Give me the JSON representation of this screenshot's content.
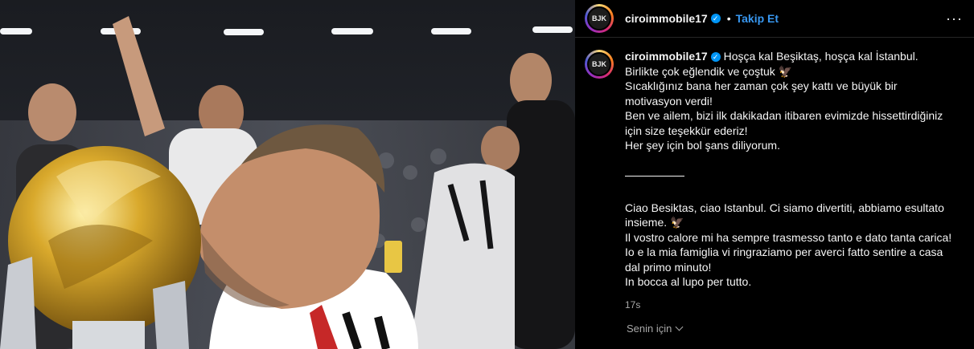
{
  "post": {
    "username": "ciroimmobile17",
    "follow_label": "Takip Et",
    "separator_dot": "•",
    "more_glyph": "···",
    "verified_glyph": "✓",
    "avatar_label": "BJK"
  },
  "caption": {
    "username": "ciroimmobile17",
    "lines": [
      "Hoşça kal Beşiktaş, hoşça kal İstanbul. Birlikte çok eğlendik ve çoştuk 🦅",
      "Sıcaklığınız bana her zaman çok şey kattı ve büyük bir motivasyon verdi!",
      "Ben ve ailem, bizi ilk dakikadan itibaren evimizde hissettirdiğiniz için size teşekkür ederiz!",
      "Her şey için bol şans diliyorum."
    ],
    "lines_it": [
      "Ciao Besiktas, ciao Istanbul. Ci siamo divertiti, abbiamo esultato insieme. 🦅",
      "Il vostro calore mi ha sempre trasmesso tanto e dato tanta carica!",
      "Io e la mia famiglia vi ringraziamo per averci fatto sentire a casa dal primo minuto!",
      "In bocca al lupo per tutto."
    ],
    "timestamp": "17s"
  },
  "footer": {
    "for_you_label": "Senin için"
  },
  "colors": {
    "accent": "#3897f0",
    "verified": "#0095f6",
    "background": "#000000",
    "muted": "#a8a8a8"
  },
  "icons": [
    "verified-badge-icon",
    "more-options-icon",
    "chevron-down-icon"
  ]
}
